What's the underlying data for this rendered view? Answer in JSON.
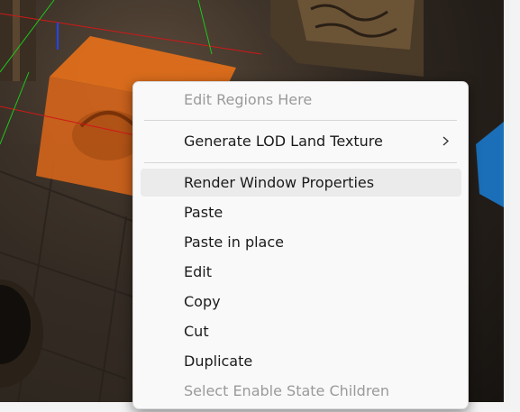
{
  "context_menu": {
    "items": [
      {
        "label": "Edit Regions Here",
        "enabled": false,
        "submenu": false
      },
      {
        "label": "Generate LOD Land Texture",
        "enabled": true,
        "submenu": true
      },
      {
        "label": "Render Window Properties",
        "enabled": true,
        "submenu": false,
        "highlighted": true
      },
      {
        "label": "Paste",
        "enabled": true,
        "submenu": false
      },
      {
        "label": "Paste in place",
        "enabled": true,
        "submenu": false
      },
      {
        "label": "Edit",
        "enabled": true,
        "submenu": false
      },
      {
        "label": "Copy",
        "enabled": true,
        "submenu": false
      },
      {
        "label": "Cut",
        "enabled": true,
        "submenu": false
      },
      {
        "label": "Duplicate",
        "enabled": true,
        "submenu": false
      },
      {
        "label": "Select Enable State Children",
        "enabled": false,
        "submenu": false
      }
    ]
  },
  "icons": {
    "submenu_arrow": "chevron-right-icon"
  },
  "colors": {
    "selection_box": "#e8701a",
    "menu_background": "#f9f9f9",
    "menu_hover": "#ebebeb",
    "disabled_text": "#9a9a9a"
  }
}
